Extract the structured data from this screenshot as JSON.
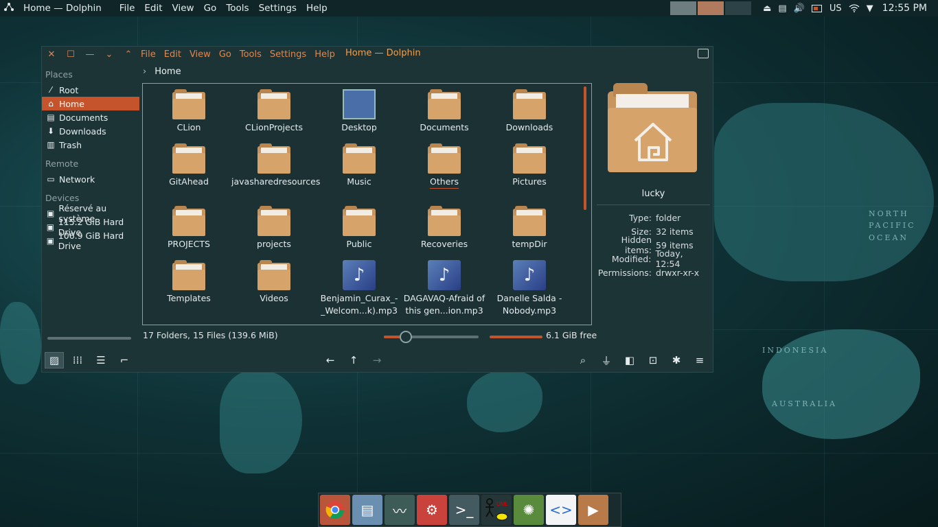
{
  "panel": {
    "title": "Home — Dolphin",
    "menu": [
      "File",
      "Edit",
      "View",
      "Go",
      "Tools",
      "Settings",
      "Help"
    ],
    "keyboard": "US",
    "clock": "12:55 PM"
  },
  "window": {
    "title": "Home — Dolphin",
    "menu": [
      "File",
      "Edit",
      "View",
      "Go",
      "Tools",
      "Settings",
      "Help"
    ],
    "breadcrumb": "Home"
  },
  "sidebar": {
    "places_header": "Places",
    "places": [
      {
        "label": "Root",
        "icon": "root-icon"
      },
      {
        "label": "Home",
        "icon": "home-icon"
      },
      {
        "label": "Documents",
        "icon": "documents-icon"
      },
      {
        "label": "Downloads",
        "icon": "downloads-icon"
      },
      {
        "label": "Trash",
        "icon": "trash-icon"
      }
    ],
    "remote_header": "Remote",
    "remote": [
      {
        "label": "Network",
        "icon": "network-icon"
      }
    ],
    "devices_header": "Devices",
    "devices": [
      {
        "label": "Réservé au système",
        "icon": "drive-icon"
      },
      {
        "label": "115.2 GiB Hard Drive",
        "icon": "drive-icon"
      },
      {
        "label": "106.9 GiB Hard Drive",
        "icon": "drive-icon"
      }
    ]
  },
  "files": [
    {
      "name": "CLion",
      "kind": "folder"
    },
    {
      "name": "CLionProjects",
      "kind": "folder"
    },
    {
      "name": "Desktop",
      "kind": "desktop"
    },
    {
      "name": "Documents",
      "kind": "folder"
    },
    {
      "name": "Downloads",
      "kind": "folder"
    },
    {
      "name": "GitAhead",
      "kind": "folder"
    },
    {
      "name": "javasharedresources",
      "kind": "folder"
    },
    {
      "name": "Music",
      "kind": "folder"
    },
    {
      "name": "Others",
      "kind": "folder"
    },
    {
      "name": "Pictures",
      "kind": "folder"
    },
    {
      "name": "PROJECTS",
      "kind": "folder"
    },
    {
      "name": "projects",
      "kind": "folder"
    },
    {
      "name": "Public",
      "kind": "folder"
    },
    {
      "name": "Recoveries",
      "kind": "folder"
    },
    {
      "name": "tempDir",
      "kind": "folder"
    },
    {
      "name": "Templates",
      "kind": "folder"
    },
    {
      "name": "Videos",
      "kind": "folder"
    },
    {
      "name": "Benjamin_Curax_-_Welcom...k).mp3",
      "kind": "audio"
    },
    {
      "name": "DAGAVAQ-Afraid of this gen...ion.mp3",
      "kind": "audio"
    },
    {
      "name": "Danelle  Salda - Nobody.mp3",
      "kind": "audio"
    }
  ],
  "info": {
    "name": "lucky",
    "rows": [
      {
        "k": "Type:",
        "v": "folder"
      },
      {
        "k": "Size:",
        "v": "32 items"
      },
      {
        "k": "Hidden items:",
        "v": "59 items"
      },
      {
        "k": "Modified:",
        "v": "Today, 12:54"
      },
      {
        "k": "Permissions:",
        "v": "drwxr-xr-x"
      }
    ]
  },
  "status": {
    "summary": "17 Folders, 15 Files (139.6 MiB)",
    "free": "6.1 GiB free",
    "zoom_level": 0.23,
    "disk_used": 0.92
  },
  "colors": {
    "accent": "#c5542c",
    "menu_text": "#e0874f",
    "window_bg": "#1d3437"
  }
}
